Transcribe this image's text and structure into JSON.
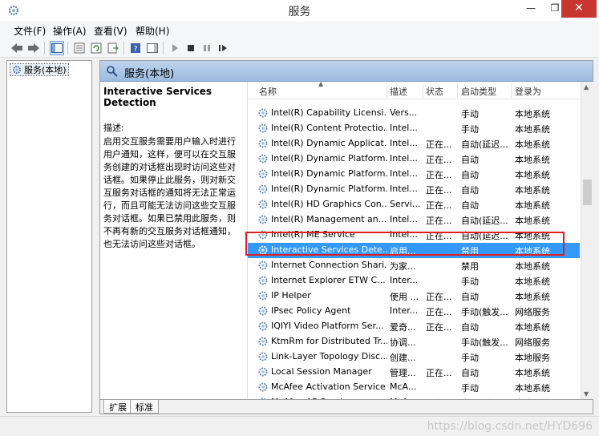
{
  "window": {
    "title": "服务",
    "minimize": "—",
    "maximize": "❐",
    "close": "✕"
  },
  "menu": [
    "文件(F)",
    "操作(A)",
    "查看(V)",
    "帮助(H)"
  ],
  "tree": {
    "root_label": "服务(本地)"
  },
  "main_header": {
    "title": "服务(本地)"
  },
  "detail": {
    "service_name": "Interactive Services Detection",
    "desc_label": "描述:",
    "desc_text": "启用交互服务需要用户输入时进行用户通知，这样，便可以在交互服务创建的对话框出现时访问这些对话框。如果停止此服务，则对新交互服务对话框的通知将无法正常运行，而且可能无法访问这些交互服务对话框。如果已禁用此服务，则不再有新的交互服务对话框通知，也无法访问这些对话框。"
  },
  "columns": {
    "name": "名称",
    "desc": "描述",
    "status": "状态",
    "startup": "启动类型",
    "logon": "登录为"
  },
  "services": [
    {
      "name": "Intel(R) Capability Licensi...",
      "desc": "Vers...",
      "status": "",
      "startup": "手动",
      "logon": "本地系统"
    },
    {
      "name": "Intel(R) Content Protectio...",
      "desc": "Intel...",
      "status": "",
      "startup": "手动",
      "logon": "本地系统"
    },
    {
      "name": "Intel(R) Dynamic Applicat...",
      "desc": "Intel...",
      "status": "正在...",
      "startup": "自动(延迟...",
      "logon": "本地系统"
    },
    {
      "name": "Intel(R) Dynamic Platform...",
      "desc": "Intel...",
      "status": "正在...",
      "startup": "自动",
      "logon": "本地系统"
    },
    {
      "name": "Intel(R) Dynamic Platform...",
      "desc": "Intel...",
      "status": "正在...",
      "startup": "自动",
      "logon": "本地系统"
    },
    {
      "name": "Intel(R) Dynamic Platform...",
      "desc": "Intel...",
      "status": "正在...",
      "startup": "自动",
      "logon": "本地系统"
    },
    {
      "name": "Intel(R) HD Graphics Con...",
      "desc": "Servi...",
      "status": "正在...",
      "startup": "自动",
      "logon": "本地系统"
    },
    {
      "name": "Intel(R) Management an...",
      "desc": "Intel...",
      "status": "正在...",
      "startup": "自动(延迟...",
      "logon": "本地系统"
    },
    {
      "name": "Intel(R) ME Service",
      "desc": "Intel...",
      "status": "正在...",
      "startup": "自动(延迟...",
      "logon": "本地系统"
    },
    {
      "name": "Interactive Services Dete...",
      "desc": "启用...",
      "status": "",
      "startup": "禁用",
      "logon": "本地系统",
      "selected": true
    },
    {
      "name": "Internet Connection Shari...",
      "desc": "为家...",
      "status": "",
      "startup": "禁用",
      "logon": "本地系统"
    },
    {
      "name": "Internet Explorer ETW C...",
      "desc": "Inter...",
      "status": "",
      "startup": "手动",
      "logon": "本地系统"
    },
    {
      "name": "IP Helper",
      "desc": "使用 ...",
      "status": "正在...",
      "startup": "自动",
      "logon": "本地系统"
    },
    {
      "name": "IPsec Policy Agent",
      "desc": "Inter...",
      "status": "正在...",
      "startup": "手动(触发...",
      "logon": "网络服务"
    },
    {
      "name": "IQIYI Video Platform Ser...",
      "desc": "爱奇...",
      "status": "正在...",
      "startup": "自动",
      "logon": "本地系统"
    },
    {
      "name": "KtmRm for Distributed Tr...",
      "desc": "协调...",
      "status": "",
      "startup": "手动(触发...",
      "logon": "网络服务"
    },
    {
      "name": "Link-Layer Topology Disc...",
      "desc": "创建...",
      "status": "",
      "startup": "手动",
      "logon": "本地服务"
    },
    {
      "name": "Local Session Manager",
      "desc": "管理...",
      "status": "正在...",
      "startup": "自动",
      "logon": "本地系统"
    },
    {
      "name": "McAfee Activation Service",
      "desc": "McA...",
      "status": "",
      "startup": "手动",
      "logon": "本地系统"
    },
    {
      "name": "McAfee AP Service",
      "desc": "McA...",
      "status": "正在...",
      "startup": "自动(延迟...",
      "logon": "本地系统"
    }
  ],
  "tabs": [
    "扩展",
    "标准"
  ],
  "watermark": "https://blog.csdn.net/HYD696"
}
